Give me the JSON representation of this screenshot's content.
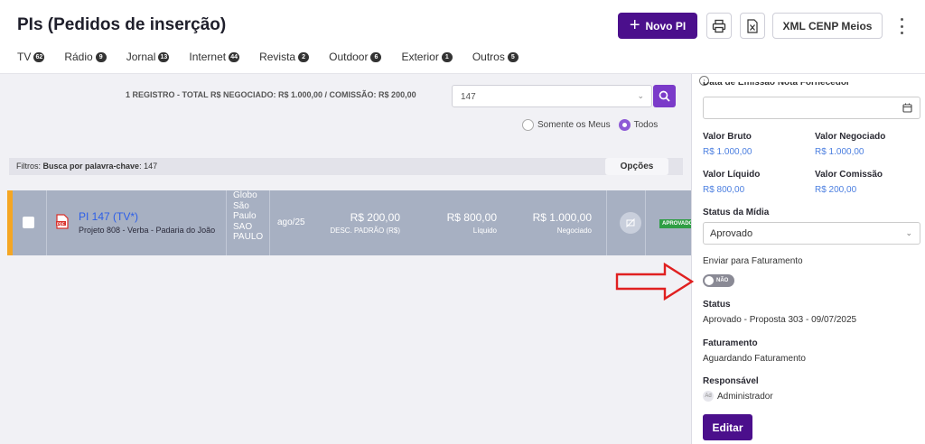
{
  "header": {
    "title": "PIs (Pedidos de inserção)",
    "new_button": "Novo PI",
    "xml_button": "XML CENP Meios"
  },
  "tabs": [
    {
      "label": "TV",
      "count": "62"
    },
    {
      "label": "Rádio",
      "count": "9"
    },
    {
      "label": "Jornal",
      "count": "13"
    },
    {
      "label": "Internet",
      "count": "44"
    },
    {
      "label": "Revista",
      "count": "2"
    },
    {
      "label": "Outdoor",
      "count": "6"
    },
    {
      "label": "Exterior",
      "count": "1"
    },
    {
      "label": "Outros",
      "count": "5"
    }
  ],
  "toolbar": {
    "summary": "1 REGISTRO - TOTAL R$ NEGOCIADO: R$ 1.000,00 / COMISSÃO: R$ 200,00",
    "search_value": "147",
    "radio_mine": "Somente os Meus",
    "radio_all": "Todos",
    "filters_label": "Filtros:",
    "filters_value": "Busca por palavra-chave",
    "filters_term": ": 147",
    "options_button": "Opções"
  },
  "row": {
    "title": "PI 147 (TV*)",
    "subtitle": "Projeto 808 - Verba - Padaria do João",
    "vehicle": [
      "Globo",
      "São",
      "Paulo",
      "SAO",
      "PAULO"
    ],
    "period": "ago/25",
    "commission_value": "R$ 200,00",
    "commission_label": "DESC. PADRÃO (R$)",
    "net_value": "R$ 800,00",
    "net_label": "Líquido",
    "negotiated_value": "R$ 1.000,00",
    "negotiated_label": "Negociado",
    "status": "APROVADO"
  },
  "panel": {
    "cut_label": "Data de Emissão Nota Fornecedor",
    "gross_label": "Valor Bruto",
    "gross_value": "R$ 1.000,00",
    "negotiated_label": "Valor Negociado",
    "negotiated_value": "R$ 1.000,00",
    "net_label": "Valor Líquido",
    "net_value": "R$ 800,00",
    "commission_label": "Valor Comissão",
    "commission_value": "R$ 200,00",
    "media_status_label": "Status da Mídia",
    "media_status_value": "Aprovado",
    "billing_send_label": "Enviar para Faturamento",
    "billing_send_toggle": "NÃO",
    "status_label": "Status",
    "status_value": "Aprovado - Proposta 303 - 09/07/2025",
    "billing_label": "Faturamento",
    "billing_value": "Aguardando Faturamento",
    "owner_label": "Responsável",
    "owner_initials": "Ad",
    "owner_value": "Administrador",
    "edit_button": "Editar"
  },
  "colors": {
    "brand": "#4b0f8c",
    "accent": "#7b3bc9",
    "row_marker": "#f5a623",
    "status_approved": "#2f9e44",
    "annotation_arrow": "#e02020"
  }
}
